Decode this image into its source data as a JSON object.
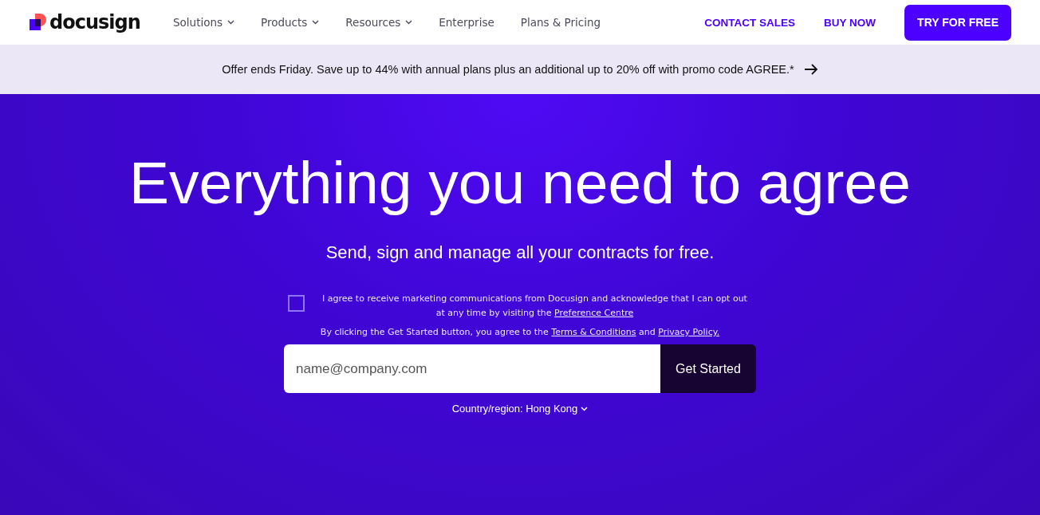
{
  "logo": {
    "text": "docusign"
  },
  "nav": [
    {
      "label": "Solutions",
      "has_menu": true
    },
    {
      "label": "Products",
      "has_menu": true
    },
    {
      "label": "Resources",
      "has_menu": true
    },
    {
      "label": "Enterprise",
      "has_menu": false
    },
    {
      "label": "Plans & Pricing",
      "has_menu": false
    }
  ],
  "actions": [
    {
      "label": "CONTACT SALES",
      "kind": "link"
    },
    {
      "label": "BUY NOW",
      "kind": "link"
    },
    {
      "label": "TRY FOR FREE",
      "kind": "primary"
    }
  ],
  "banner": {
    "text": "Offer ends Friday. Save up to 44% with annual plans plus an additional up to 20% off with promo code AGREE.*"
  },
  "hero": {
    "title": "Everything you need to agree",
    "subtitle": "Send, sign and manage all your contracts for free.",
    "consent": {
      "checked": false,
      "text": "I agree to receive marketing communications from Docusign and acknowledge that I can opt out at any time by visiting the ",
      "link": "Preference Centre"
    },
    "terms": {
      "text": "By clicking the Get Started button, you agree to the ",
      "link_1": "Terms & Conditions",
      "middle": " and ",
      "link_2": "Privacy Policy."
    },
    "email": {
      "placeholder": "name@company.com"
    },
    "submit": "Get Started",
    "region": "Country/region: Hong Kong"
  }
}
